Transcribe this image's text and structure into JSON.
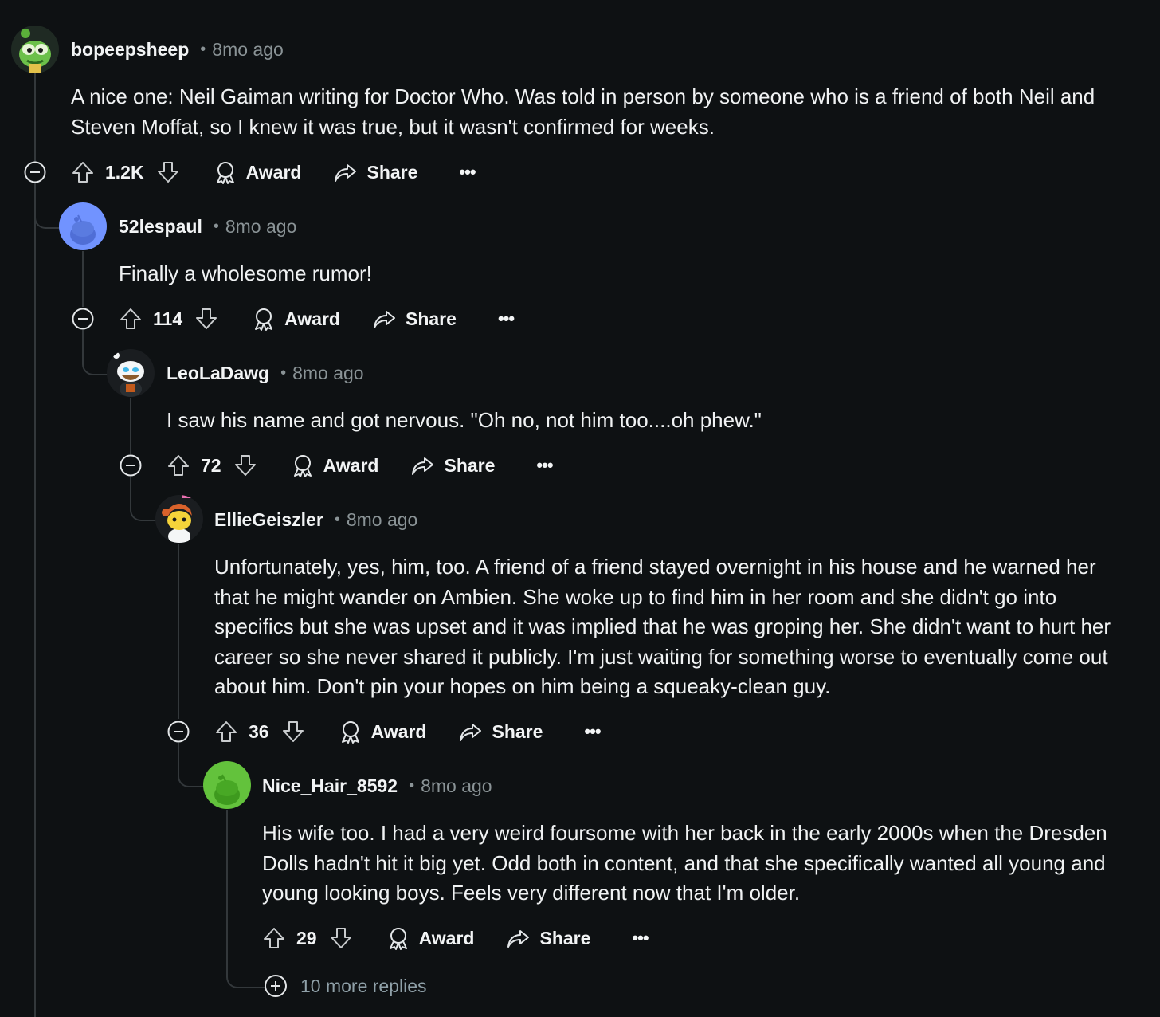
{
  "colors": {
    "background": "#0e1113",
    "text": "#f0f2f3",
    "muted": "#8a9396",
    "thread_line": "#33383b"
  },
  "comments": [
    {
      "username": "bopeepsheep",
      "time": "8mo ago",
      "text": "A nice one: Neil Gaiman writing for Doctor Who. Was told in person by someone who is a friend of both Neil and Steven Moffat, so I knew it was true, but it wasn't confirmed for weeks.",
      "score": "1.2K",
      "award_label": "Award",
      "share_label": "Share",
      "more_label": "•••",
      "avatar_icon": "green-creature-avatar"
    },
    {
      "username": "52lespaul",
      "time": "8mo ago",
      "text": "Finally a wholesome rumor!",
      "score": "114",
      "award_label": "Award",
      "share_label": "Share",
      "more_label": "•••",
      "avatar_icon": "default-snoo-avatar-blue"
    },
    {
      "username": "LeoLaDawg",
      "time": "8mo ago",
      "text": "I saw his name and got nervous. \"Oh no, not him too....oh phew.\"",
      "score": "72",
      "award_label": "Award",
      "share_label": "Share",
      "more_label": "•••",
      "avatar_icon": "snoo-avatar-bearded"
    },
    {
      "username": "EllieGeiszler",
      "time": "8mo ago",
      "text": "Unfortunately, yes, him, too. A friend of a friend stayed overnight in his house and he warned her that he might wander on Ambien. She woke up to find him in her room and she didn't go into specifics but she was upset and it was implied that he was groping her. She didn't want to hurt her career so she never shared it publicly. I'm just waiting for something worse to eventually come out about him. Don't pin your hopes on him being a squeaky-clean guy.",
      "score": "36",
      "award_label": "Award",
      "share_label": "Share",
      "more_label": "•••",
      "avatar_icon": "snoo-avatar-orange-hair"
    },
    {
      "username": "Nice_Hair_8592",
      "time": "8mo ago",
      "text": "His wife too. I had a very weird foursome with her back in the early 2000s when the Dresden Dolls hadn't hit it big yet. Odd both in content, and that she specifically wanted all young and young looking boys. Feels very different now that I'm older.",
      "score": "29",
      "award_label": "Award",
      "share_label": "Share",
      "more_label": "•••",
      "avatar_icon": "default-snoo-avatar-green"
    }
  ],
  "more_replies": "10 more replies"
}
